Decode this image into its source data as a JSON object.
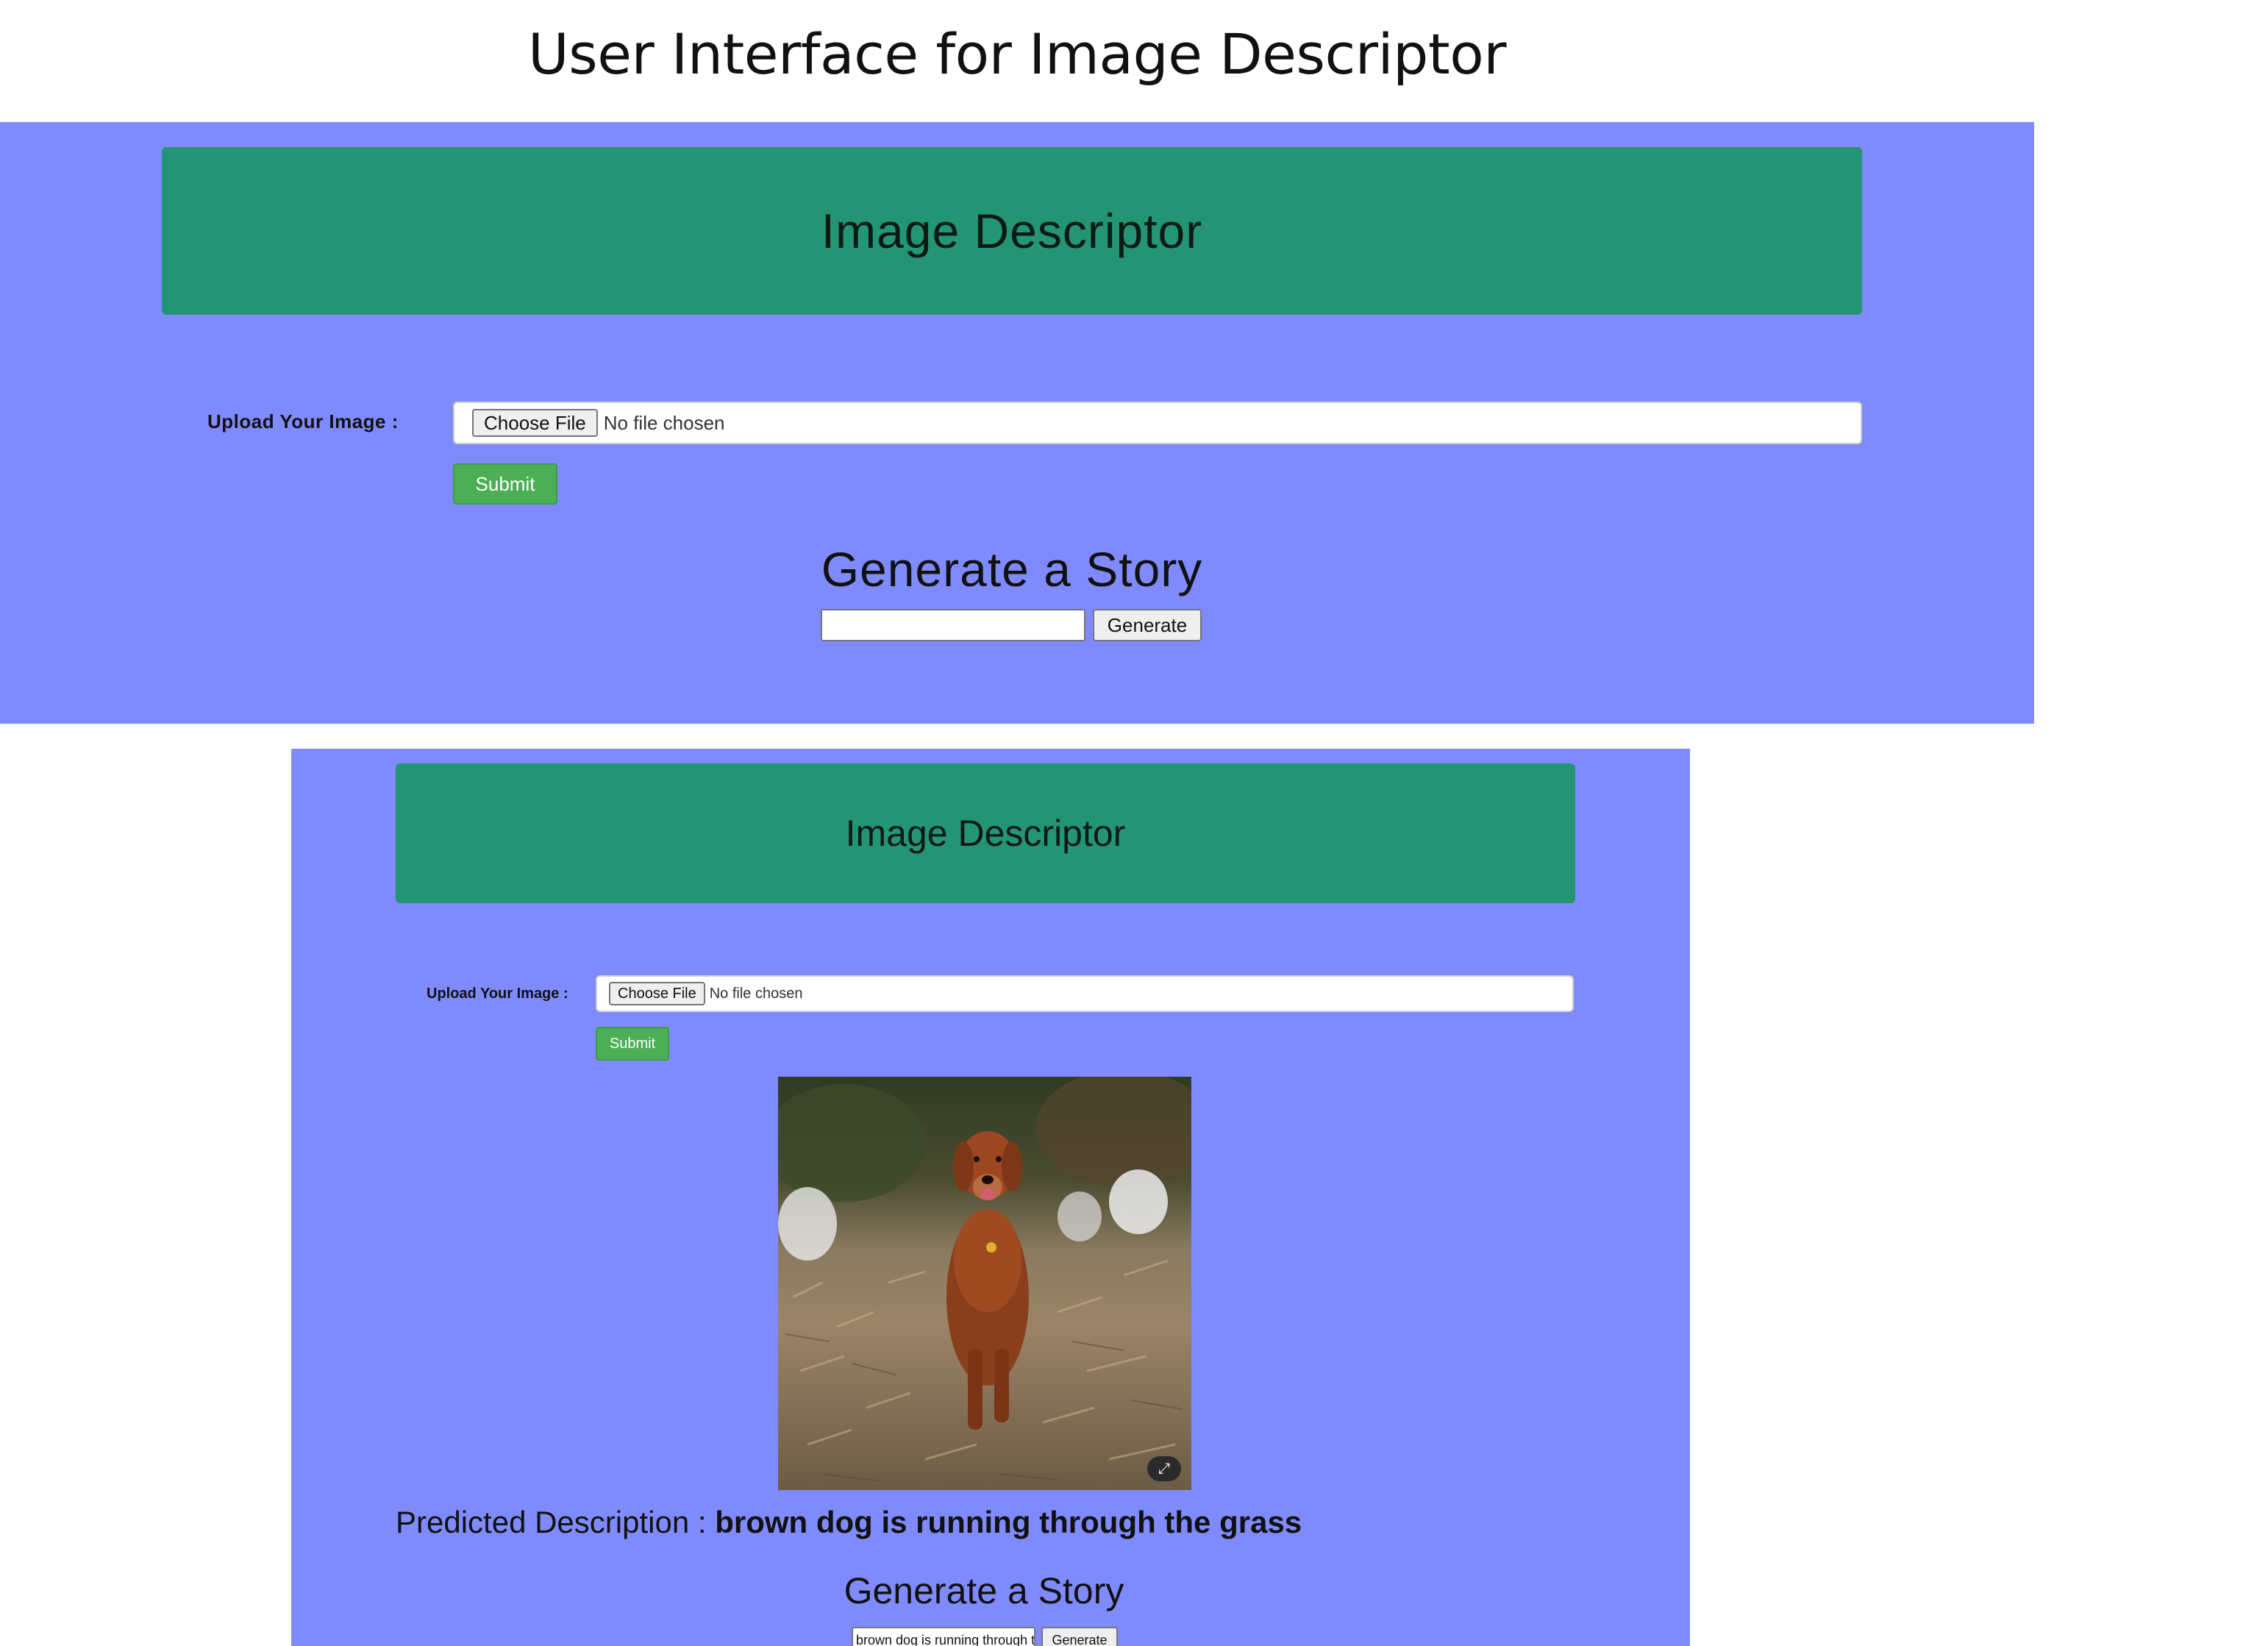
{
  "figure_title": "User Interface for Image Descriptor",
  "screen_before": {
    "app_title": "Image Descriptor",
    "upload_label": "Upload Your Image :",
    "choose_file_label": "Choose File",
    "file_status": "No file chosen",
    "submit_label": "Submit",
    "story_heading": "Generate a Story",
    "story_input_value": "",
    "generate_label": "Generate"
  },
  "screen_after": {
    "app_title": "Image Descriptor",
    "upload_label": "Upload Your Image :",
    "choose_file_label": "Choose File",
    "file_status": "No file chosen",
    "submit_label": "Submit",
    "uploaded_image": "photo of a brown dog running through dry grass",
    "image_badge_icon": "expand-icon",
    "prediction_label": "Predicted Description :",
    "prediction_value": "brown dog is running through the grass",
    "story_heading": "Generate a Story",
    "story_input_value": "brown dog is running through the grass",
    "generate_label": "Generate"
  },
  "colors": {
    "page_background": "#7f8bfc",
    "banner": "#239574",
    "submit_button": "#4cae55"
  }
}
